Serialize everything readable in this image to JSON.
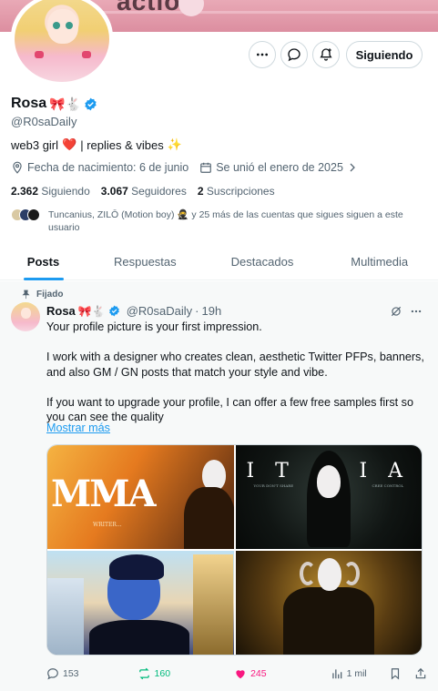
{
  "banner": {
    "text": "action"
  },
  "header": {
    "more_icon": "more-horizontal-icon",
    "message_icon": "message-bubble-icon",
    "notify_icon": "bell-plus-icon",
    "follow_label": "Siguiendo"
  },
  "profile": {
    "name": "Rosa",
    "name_emoji": "🎀🐇",
    "handle": "@R0saDaily",
    "bio_left": "web3 girl",
    "bio_heart": "❤️",
    "bio_right": "| replies & vibes",
    "bio_sparkle": "✨",
    "birthday": "Fecha de nacimiento: 6 de junio",
    "joined": "Se unió el enero de 2025",
    "following_count": "2.362",
    "following_label": "Siguiendo",
    "followers_count": "3.067",
    "followers_label": "Seguidores",
    "subs_count": "2",
    "subs_label": "Suscripciones",
    "known_followers_names": "Tuncanius, ZILŌ (Motion boy)",
    "known_followers_emoji": "🥷",
    "known_followers_rest": "y 25 más de las cuentas que sigues siguen a este usuario"
  },
  "tabs": [
    "Posts",
    "Respuestas",
    "Destacados",
    "Multimedia"
  ],
  "post": {
    "pinned_label": "Fijado",
    "author": "Rosa",
    "author_emoji": "🎀🐇",
    "handle": "@R0saDaily",
    "time": "19h",
    "text": "Your profile picture is your first impression.\n\nI work with a designer who creates clean, aesthetic Twitter PFPs, banners, and also GM / GN posts that match your style and vibe.\n\nIf you want to upgrade your profile, I can offer a few free samples first so you can see the quality",
    "show_more": "Mostrar más",
    "media": {
      "img1_title": "MMA",
      "img1_sub": "WRITER...",
      "img2_title_left": "I T",
      "img2_title_right": "I A",
      "img2_caption_left": "YOUR DON'T SHARE",
      "img2_caption_right": "CREE CONTROL"
    },
    "replies": "153",
    "reposts": "160",
    "likes": "245",
    "views": "1 mil"
  },
  "colors": {
    "accent": "#1d9bf0",
    "repost": "#00ba7c",
    "like": "#f91880",
    "muted": "#536471"
  }
}
